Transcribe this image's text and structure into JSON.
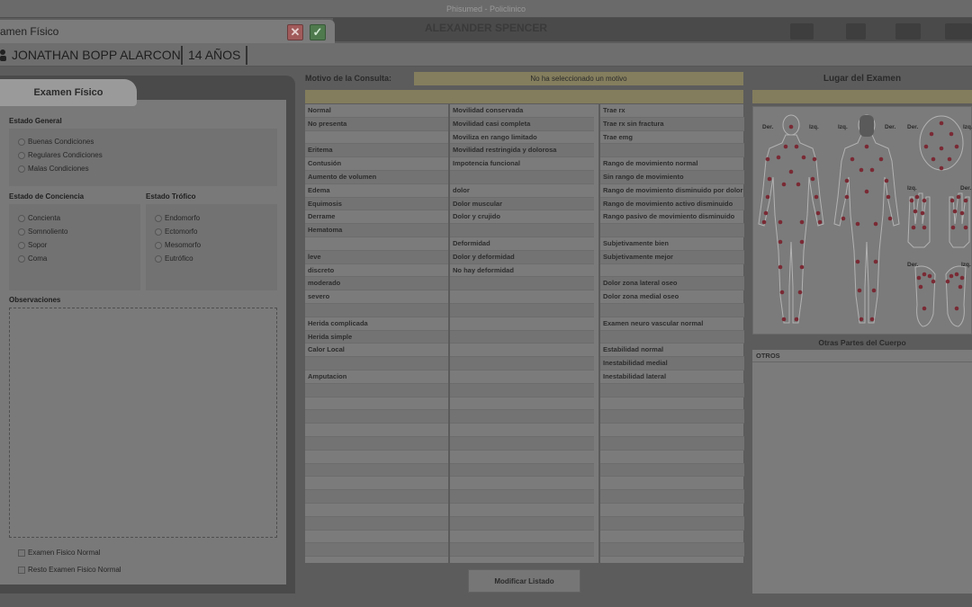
{
  "window": {
    "title": "Phisumed - Policlinico"
  },
  "background": {
    "doctor_name": "ALEXANDER SPENCER"
  },
  "modal": {
    "title": "amen Físico"
  },
  "patient": {
    "name": "JONATHAN BOPP ALARCON",
    "age": "14 AÑOS"
  },
  "left_panel": {
    "tab_label": "Examen Físico",
    "estado_general": {
      "label": "Estado General",
      "options": [
        "Buenas Condiciones",
        "Regulares Condiciones",
        "Malas Condiciones"
      ]
    },
    "estado_conciencia": {
      "label": "Estado de Conciencia",
      "options": [
        "Concienta",
        "Somnoliento",
        "Sopor",
        "Coma"
      ]
    },
    "estado_trofico": {
      "label": "Estado Trófico",
      "options": [
        "Endomorfo",
        "Ectomorfo",
        "Mesomorfo",
        "Eutrófico"
      ]
    },
    "observaciones_label": "Observaciones",
    "checkboxes": [
      "Examen Fisico Normal",
      "Resto Examen Fisico Normal"
    ]
  },
  "middle": {
    "motivo_label": "Motivo de la Consulta:",
    "motivo_value": "No ha seleccionado un motivo",
    "columns": [
      [
        "Normal",
        "No presenta",
        "",
        "Eritema",
        "Contusión",
        "Aumento de volumen",
        "Edema",
        "Equimosis",
        "Derrame",
        "Hematoma",
        "",
        "leve",
        "discreto",
        "moderado",
        "severo",
        "",
        "Herida complicada",
        "Herida simple",
        "Calor Local",
        "",
        "Amputacion",
        ""
      ],
      [
        "Movilidad conservada",
        "Movilidad casi completa",
        "Moviliza en rango limitado",
        "Movilidad restringida y dolorosa",
        "Impotencia funcional",
        "",
        "dolor",
        "Dolor muscular",
        "Dolor y crujido",
        "",
        "Deformidad",
        "Dolor y deformidad",
        "No hay deformidad"
      ],
      [
        "Trae rx",
        "Trae rx sin fractura",
        "Trae emg",
        "",
        "Rango de movimiento normal",
        "Sin rango de movimiento",
        "Rango de movimiento disminuido por dolor",
        "Rango de movimiento activo disminuido",
        "Rango pasivo de movimiento disminuido",
        "",
        "Subjetivamente bien",
        "Subjetivamente mejor",
        "",
        "Dolor zona lateral oseo",
        "Dolor zona medial oseo",
        "",
        "Examen neuro vascular normal",
        "",
        "Estabilidad normal",
        "Inestabilidad medial",
        "Inestabilidad lateral"
      ]
    ],
    "modify_button": "Modificar Listado"
  },
  "right": {
    "lugar_label": "Lugar del Examen",
    "body_labels": {
      "der": "Der.",
      "izq": "Izq."
    },
    "otras_label": "Otras Partes del Cuerpo",
    "otras_items": [
      "OTROS"
    ]
  },
  "colors": {
    "marker": "#7a2a34",
    "motivo_bg": "#847e5e",
    "overlay_bg": "#5c5c5c"
  }
}
